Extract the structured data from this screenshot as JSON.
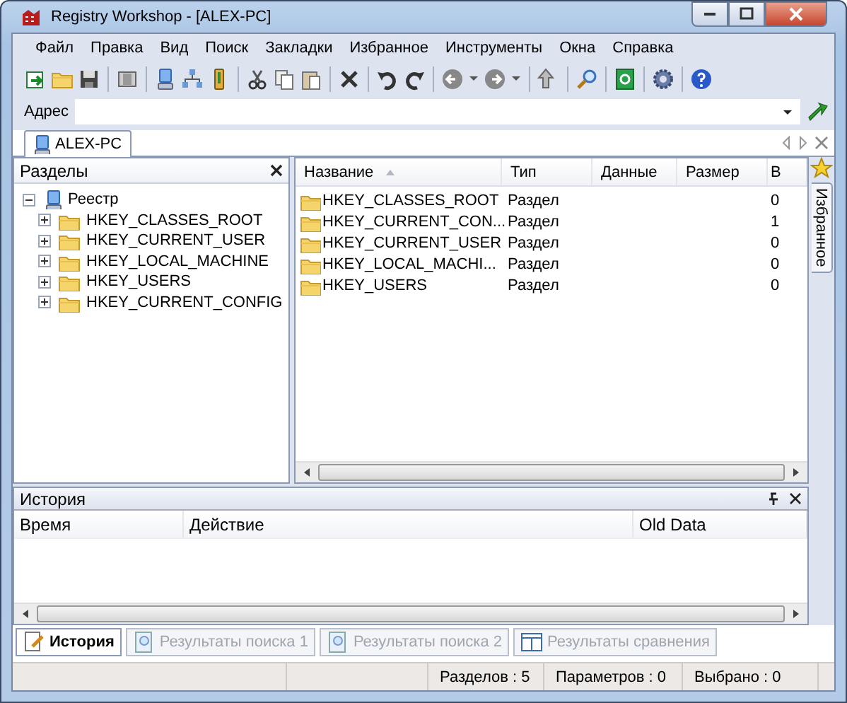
{
  "window": {
    "title": "Registry Workshop - [ALEX-PC]"
  },
  "menu": [
    {
      "label": "Файл"
    },
    {
      "label": "Правка"
    },
    {
      "label": "Вид"
    },
    {
      "label": "Поиск"
    },
    {
      "label": "Закладки"
    },
    {
      "label": "Избранное"
    },
    {
      "label": "Инструменты"
    },
    {
      "label": "Окна"
    },
    {
      "label": "Справка"
    }
  ],
  "address_bar": {
    "label": "Адрес"
  },
  "document_tabs": [
    {
      "label": "ALEX-PC",
      "selected": true
    }
  ],
  "favorites_tab": {
    "label": "Избранное"
  },
  "sections_panel": {
    "title": "Разделы",
    "tree": {
      "label": "Реестр",
      "expanded": true,
      "children": [
        {
          "label": "HKEY_CLASSES_ROOT",
          "expanded": false
        },
        {
          "label": "HKEY_CURRENT_USER",
          "expanded": false
        },
        {
          "label": "HKEY_LOCAL_MACHINE",
          "expanded": false
        },
        {
          "label": "HKEY_USERS",
          "expanded": false
        },
        {
          "label": "HKEY_CURRENT_CONFIG",
          "expanded": false
        }
      ]
    }
  },
  "keys_table": {
    "columns": [
      {
        "label": "Название",
        "sorted": true
      },
      {
        "label": "Тип",
        "sorted": false
      },
      {
        "label": "Данные",
        "sorted": false
      },
      {
        "label": "Размер",
        "sorted": false
      },
      {
        "label": "В",
        "sorted": false
      }
    ],
    "rows": [
      {
        "name": "HKEY_CLASSES_ROOT",
        "type": "Раздел",
        "column_5": "0"
      },
      {
        "name": "HKEY_CURRENT_CON...",
        "type": "Раздел",
        "column_5": "1"
      },
      {
        "name": "HKEY_CURRENT_USER",
        "type": "Раздел",
        "column_5": "0"
      },
      {
        "name": "HKEY_LOCAL_MACHI...",
        "type": "Раздел",
        "column_5": "0"
      },
      {
        "name": "HKEY_USERS",
        "type": "Раздел",
        "column_5": "0"
      }
    ]
  },
  "history_panel": {
    "title": "История",
    "columns": [
      {
        "label": "Время"
      },
      {
        "label": "Действие"
      },
      {
        "label": "Old Data"
      }
    ]
  },
  "bottom_tabs": [
    {
      "label": "История",
      "selected": true
    },
    {
      "label": "Результаты поиска 1",
      "selected": false
    },
    {
      "label": "Результаты поиска 2",
      "selected": false
    },
    {
      "label": "Результаты сравнения",
      "selected": false
    }
  ],
  "status_bar": [
    {
      "text": "Разделов : 5"
    },
    {
      "text": "Параметров : 0"
    },
    {
      "text": "Выбрано : 0"
    }
  ]
}
